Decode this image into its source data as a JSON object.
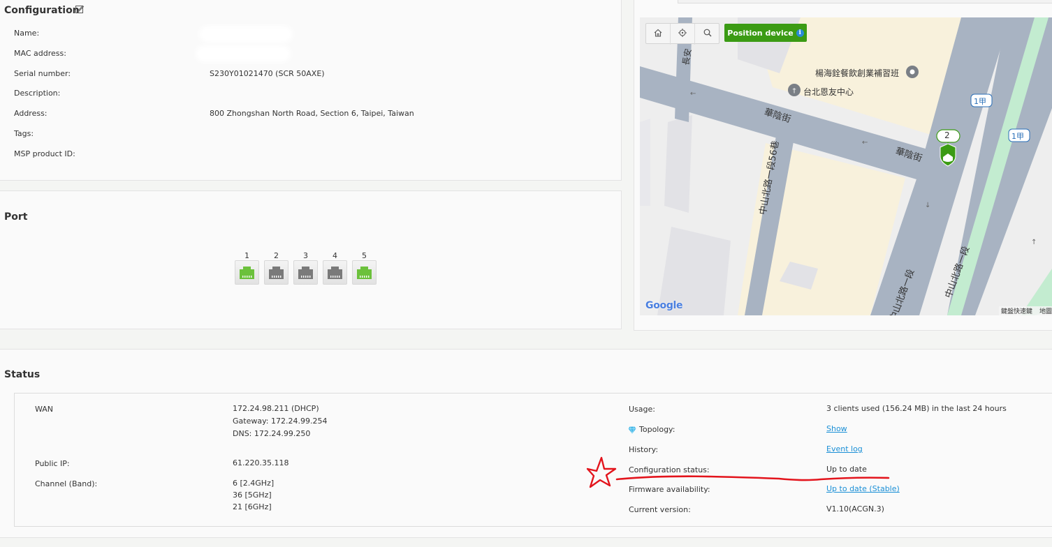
{
  "configuration": {
    "title": "Configuration",
    "fields": [
      {
        "label": "Name:",
        "value": ""
      },
      {
        "label": "MAC address:",
        "value": ""
      },
      {
        "label": "Serial number:",
        "value": "S230Y01021470 (SCR 50AXE)"
      },
      {
        "label": "Description:",
        "value": ""
      },
      {
        "label": "Address:",
        "value": "800 Zhongshan North Road, Section 6, Taipei, Taiwan"
      },
      {
        "label": "Tags:",
        "value": ""
      },
      {
        "label": "MSP product ID:",
        "value": ""
      }
    ]
  },
  "port": {
    "title": "Port",
    "ports": [
      {
        "number": "1",
        "state": "connected"
      },
      {
        "number": "2",
        "state": "disconnected"
      },
      {
        "number": "3",
        "state": "disconnected"
      },
      {
        "number": "4",
        "state": "disconnected"
      },
      {
        "number": "5",
        "state": "connected"
      }
    ],
    "colors": {
      "connected": "#6cc13c",
      "disconnected": "#7a7a7a"
    }
  },
  "map": {
    "position_device_label": "Position device",
    "info_icon": "info-icon",
    "toolbar_icons": [
      "home-icon",
      "crosshair-icon",
      "search-icon"
    ],
    "brand": "Google",
    "footer_shortcuts": "鍵盤快速鍵",
    "footer_map_data": "地圖",
    "cluster_count": "2",
    "labels": {
      "poi_1": "楊海銓餐飲創業補習班",
      "poi_2": "台北恩友中心",
      "street_1": "華陰街",
      "street_2": "華陰街",
      "street_3": "中山北路一段56巷",
      "street_4": "中山北路一段",
      "street_5": "中山北路一段",
      "street_6": "長安",
      "route_1": "1甲",
      "route_2": "1甲"
    },
    "accent": "#3b9b14"
  },
  "status": {
    "title": "Status",
    "left": [
      {
        "label": "WAN",
        "lines": [
          "172.24.98.211  (DHCP)",
          "Gateway:  172.24.99.254",
          "DNS:  172.24.99.250"
        ]
      },
      {
        "label": "Public IP:",
        "lines": [
          "61.220.35.118"
        ]
      },
      {
        "label": "Channel (Band):",
        "lines": [
          "6 [2.4GHz]",
          "36 [5GHz]",
          "21 [6GHz]"
        ]
      }
    ],
    "right": [
      {
        "label": "Usage:",
        "value": "3 clients used (156.24 MB) in the last 24 hours",
        "link": false
      },
      {
        "label": "Topology:",
        "value": "Show",
        "link": true,
        "icon": "diamond-icon"
      },
      {
        "label": "History:",
        "value": "Event log",
        "link": true
      },
      {
        "label": "Configuration status:",
        "value": "Up to date",
        "link": false
      },
      {
        "label": "Firmware availability:",
        "value": "Up to date (Stable)",
        "link": true
      },
      {
        "label": "Current version:",
        "value": "V1.10(ACGN.3)",
        "link": false
      }
    ]
  },
  "annotation": {
    "color": "#e3141c"
  }
}
